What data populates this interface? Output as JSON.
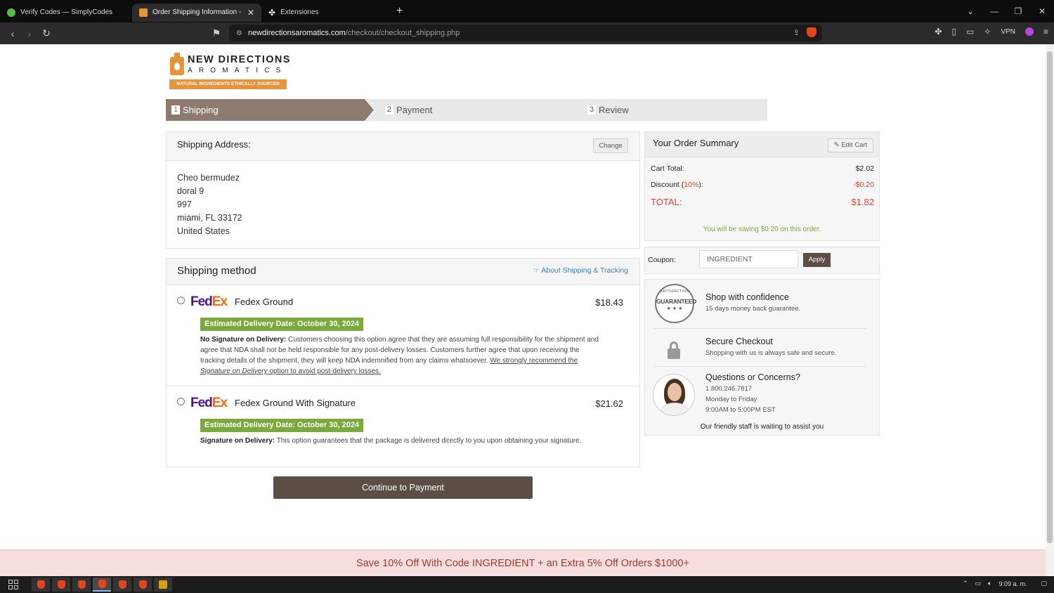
{
  "browser": {
    "tabs": [
      {
        "title": "Verify Codes — SimplyCodes"
      },
      {
        "title": "Order Shipping Information - N"
      },
      {
        "title": "Extensiones"
      }
    ],
    "url_host": "newdirectionsaromatics.com",
    "url_path": "/checkout/checkout_shipping.php",
    "vpn_label": "VPN"
  },
  "logo": {
    "line1": "NEW DIRECTIONS",
    "line2": "AROMATICS",
    "tagline": "NATURAL INGREDIENTS ETHICALLY SOURCED",
    "brand_color": "#e8923a"
  },
  "steps": [
    {
      "num": "1",
      "label": "Shipping"
    },
    {
      "num": "2",
      "label": "Payment"
    },
    {
      "num": "3",
      "label": "Review"
    }
  ],
  "shipping_address": {
    "title": "Shipping Address:",
    "change_label": "Change",
    "lines": [
      "Cheo bermudez",
      "doral 9",
      "997",
      "miami, FL 33172",
      "United States"
    ]
  },
  "shipping_method": {
    "title": "Shipping method",
    "about_link": "About Shipping & Tracking",
    "options": [
      {
        "carrier_fed": "Fed",
        "carrier_ex": "Ex",
        "name": "Fedex Ground",
        "price": "$18.43",
        "eta": "Estimated Delivery Date: October 30, 2024",
        "desc_bold": "No Signature on Delivery:",
        "desc": " Customers choosing this option agree that they are assuming full responsibility for the shipment and agree that NDA shall not be held responsible for any post-delivery losses. Customers further agree that upon receiving the tracking details of the shipment, they will keep NDA indemnified from any claims whatsoever. ",
        "desc_u1": "We strongly recommend the ",
        "desc_u2": "Signature on Delivery",
        "desc_u3": " option to avoid post-delivery losses."
      },
      {
        "carrier_fed": "Fed",
        "carrier_ex": "Ex",
        "name": "Fedex Ground With Signature",
        "price": "$21.62",
        "eta": "Estimated Delivery Date: October 30, 2024",
        "desc_bold": "Signature on Delivery:",
        "desc": " This option guarantees that the package is delivered directly to you upon obtaining your signature."
      }
    ],
    "continue_label": "Continue to Payment"
  },
  "summary": {
    "title": "Your Order Summary",
    "edit_label": "Edit Cart",
    "cart_total_label": "Cart Total:",
    "cart_total": "$2.02",
    "discount_label_pre": "Discount (",
    "discount_pct": "10%",
    "discount_label_post": "):",
    "discount": "-$0.20",
    "total_label": "TOTAL:",
    "total": "$1.82",
    "saving": "You will be saving $0.20 on this order."
  },
  "coupon": {
    "label": "Coupon:",
    "value": "INGREDIENT",
    "apply_label": "Apply"
  },
  "confidence": {
    "seal_top": "SATISFACTION",
    "seal_mid": "GUARANTEED",
    "seal_stars": "★ ★ ★",
    "shop_title": "Shop with confidence",
    "shop_text": "15 days money back guarantee.",
    "secure_title": "Secure Checkout",
    "secure_text": "Shopping with us is always safe and secure.",
    "questions_title": "Questions or Concerns?",
    "phone": "1.800.246.7817",
    "days": "Monday to Friday",
    "hours": "9:00AM to 5:00PM EST",
    "friendly": "Our friendly staff is waiting to assist you"
  },
  "promo": {
    "text": "Save 10% Off With Code INGREDIENT + an Extra 5% Off Orders $1000+"
  },
  "taskbar": {
    "clock": "9:09 a. m."
  },
  "colors": {
    "step_active": "#8d7b6f",
    "button": "#5c4e45",
    "eta_green": "#7aa93c",
    "total_red": "#e0433a",
    "promo_bg": "#f6dede"
  }
}
